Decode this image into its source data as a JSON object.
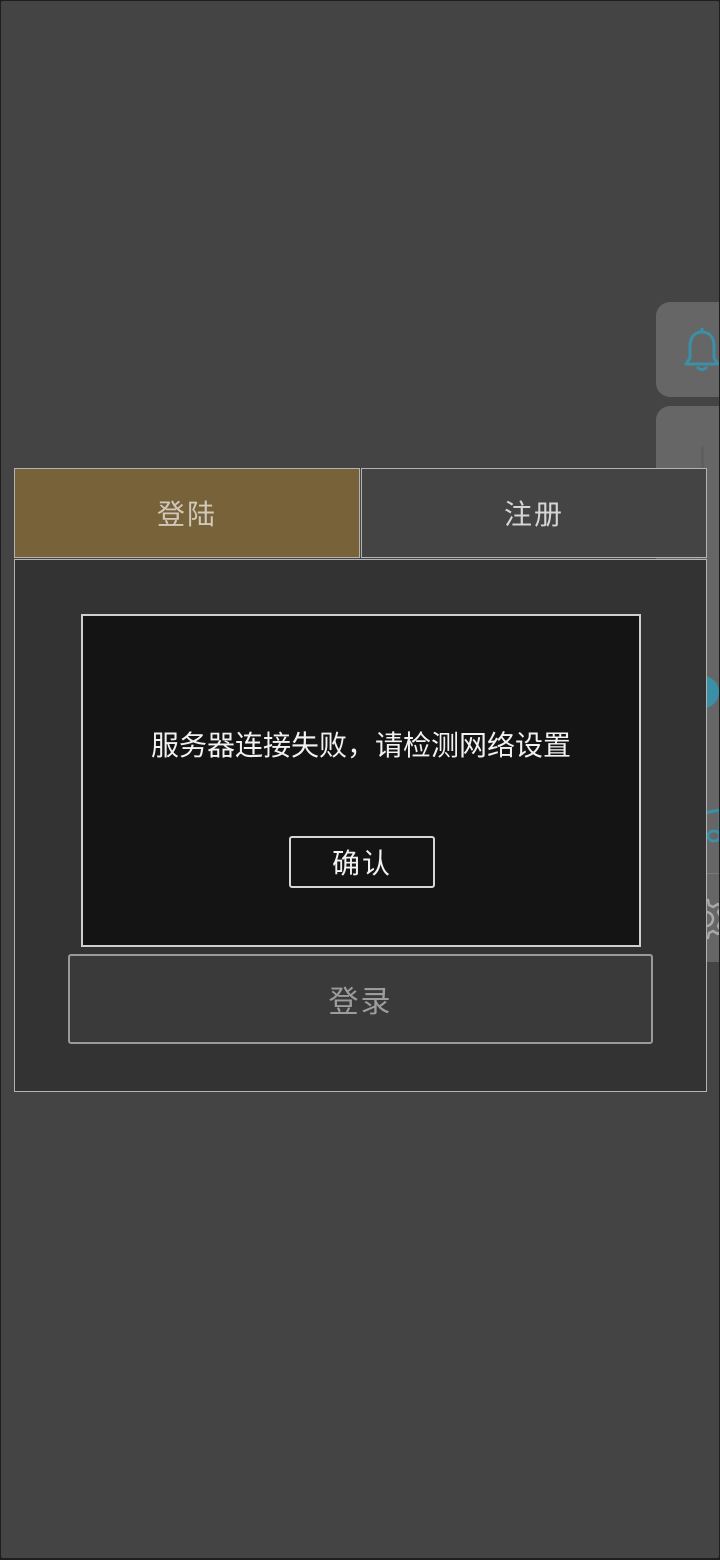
{
  "tabs": {
    "login_label": "登陆",
    "register_label": "注册",
    "active": "login"
  },
  "form": {
    "login_button_label": "登录"
  },
  "dialog": {
    "message": "服务器连接失败，请检测网络设置",
    "confirm_label": "确认"
  },
  "side_panel": {
    "icons": [
      "bell-icon",
      "music-icon",
      "gear-icon"
    ],
    "slider_level": 0.23
  },
  "colors": {
    "active_tab": "#77623a",
    "accent": "#3b8fa6",
    "dialog_bg": "#141414"
  }
}
